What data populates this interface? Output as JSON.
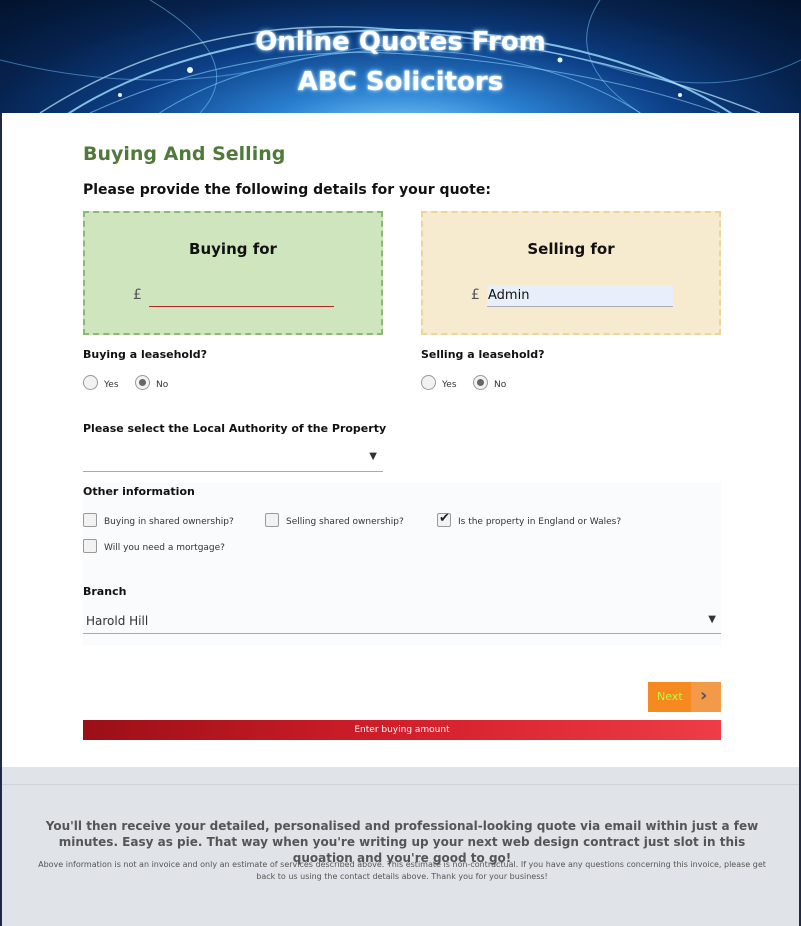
{
  "header": {
    "title_line1": "Online Quotes From",
    "title_line2": "ABC Solicitors"
  },
  "form": {
    "section_title": "Buying And Selling",
    "instructions": "Please provide the following details for your quote:",
    "buying": {
      "title": "Buying for",
      "currency": "£",
      "value": "",
      "leasehold_label": "Buying a leasehold?",
      "options": [
        "Yes",
        "No"
      ],
      "selected": "No"
    },
    "selling": {
      "title": "Selling for",
      "currency": "£",
      "value": "Admin",
      "leasehold_label": "Selling a leasehold?",
      "options": [
        "Yes",
        "No"
      ],
      "selected": "No"
    },
    "local_authority": {
      "label": "Please select the Local Authority of the Property",
      "value": ""
    },
    "other_information": {
      "label": "Other information",
      "checkboxes": [
        {
          "label": "Buying in shared ownership?",
          "checked": false
        },
        {
          "label": "Selling shared ownership?",
          "checked": false
        },
        {
          "label": "Is the property in England or Wales?",
          "checked": true
        },
        {
          "label": "Will you need a mortgage?",
          "checked": false
        }
      ]
    },
    "branch": {
      "label": "Branch",
      "value": "Harold Hill"
    },
    "next_label": "Next",
    "error_message": "Enter buying amount"
  },
  "footer": {
    "main_text": "You'll then receive your detailed, personalised and professional-looking quote via email within just a few minutes. Easy as pie. That way when you're writing up your next web design contract just slot in this quoation and you're good to go!",
    "note": "Above information is not an invoice and only an estimate of services described above. This estimate is non-contractual. If you have any questions concerning this invoice, please get back to us using the contact details above. Thank you for your business!"
  },
  "colors": {
    "section_title": "#4f7a3a",
    "buying_box": "#cfe5bd",
    "selling_box": "#f6ebce",
    "next_button": "#f6891f",
    "error_bar": "#d31f2b"
  },
  "icons": {
    "dropdown": "chevron-down-icon",
    "next": "chevron-right-icon",
    "check": "checkmark-icon"
  }
}
